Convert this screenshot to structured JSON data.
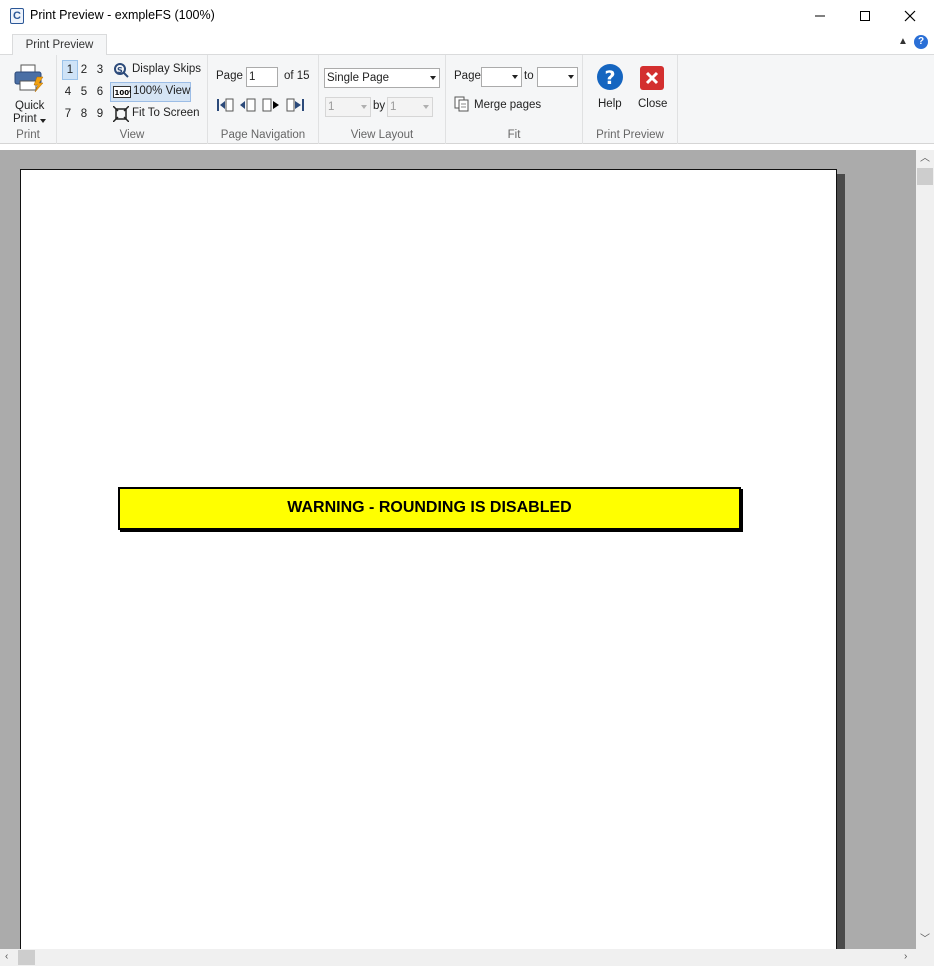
{
  "window": {
    "title": "Print Preview - exmpleFS (100%)",
    "app_icon_letter": "C"
  },
  "ribbon_tab": {
    "label": "Print Preview"
  },
  "print_group": {
    "quick_print_label_line1": "Quick",
    "quick_print_label_line2": "Print",
    "group_label": "Print"
  },
  "view_group": {
    "numbers": [
      "1",
      "2",
      "3",
      "4",
      "5",
      "6",
      "7",
      "8",
      "9"
    ],
    "selected_number": "1",
    "display_skips_label": "Display Skips",
    "view_100_label": "100% View",
    "fit_to_screen_label": "Fit To Screen",
    "group_label": "View"
  },
  "page_navigation": {
    "page_label": "Page",
    "page_value": "1",
    "of_label": "of 15",
    "group_label": "Page Navigation"
  },
  "view_layout": {
    "layout_value": "Single Page",
    "rows_value": "1",
    "by_label": "by",
    "cols_value": "1",
    "group_label": "View Layout"
  },
  "fit_group": {
    "page_label": "Page",
    "to_label": "to",
    "from_value": "",
    "to_value": "",
    "merge_pages_label": "Merge pages",
    "group_label": "Fit"
  },
  "preview_group": {
    "help_label": "Help",
    "close_label": "Close",
    "group_label": "Print Preview"
  },
  "document": {
    "warning_text": "WARNING - ROUNDING IS DISABLED"
  },
  "colors": {
    "warning_fill": "#ffff00",
    "workspace": "#ababab",
    "help_blue": "#1565c0",
    "close_red": "#d32f2f"
  }
}
